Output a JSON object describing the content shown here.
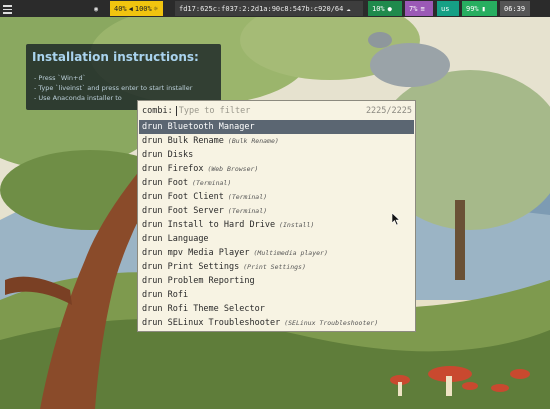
{
  "topbar": {
    "volume": "40%",
    "brightness": "100%",
    "ip": "fd17:625c:f037:2:2d1a:90c8:547b:c920/64",
    "disk": "10%",
    "mem": "7%",
    "keyboard": "us",
    "battery": "99%",
    "clock": "06:39"
  },
  "instructions": {
    "title": "Installation instructions:",
    "lines": [
      "- Press `Win+d`",
      "- Type `liveinst` and press enter to start installer",
      "- Use Anaconda installer to"
    ]
  },
  "rofi": {
    "prompt": "combi:",
    "placeholder": "Type to filter",
    "count": "2225/2225",
    "items": [
      {
        "mode": "drun",
        "name": "Bluetooth Manager",
        "sub": ""
      },
      {
        "mode": "drun",
        "name": "Bulk Rename",
        "sub": "(Bulk Rename)"
      },
      {
        "mode": "drun",
        "name": "Disks",
        "sub": ""
      },
      {
        "mode": "drun",
        "name": "Firefox",
        "sub": "(Web Browser)"
      },
      {
        "mode": "drun",
        "name": "Foot",
        "sub": "(Terminal)"
      },
      {
        "mode": "drun",
        "name": "Foot Client",
        "sub": "(Terminal)"
      },
      {
        "mode": "drun",
        "name": "Foot Server",
        "sub": "(Terminal)"
      },
      {
        "mode": "drun",
        "name": "Install to Hard Drive",
        "sub": "(Install)"
      },
      {
        "mode": "drun",
        "name": "Language",
        "sub": ""
      },
      {
        "mode": "drun",
        "name": "mpv Media Player",
        "sub": "(Multimedia player)"
      },
      {
        "mode": "drun",
        "name": "Print Settings",
        "sub": "(Print Settings)"
      },
      {
        "mode": "drun",
        "name": "Problem Reporting",
        "sub": ""
      },
      {
        "mode": "drun",
        "name": "Rofi",
        "sub": ""
      },
      {
        "mode": "drun",
        "name": "Rofi Theme Selector",
        "sub": ""
      },
      {
        "mode": "drun",
        "name": "SELinux Troubleshooter",
        "sub": "(SELinux Troubleshooter)"
      }
    ],
    "selected_index": 0
  }
}
